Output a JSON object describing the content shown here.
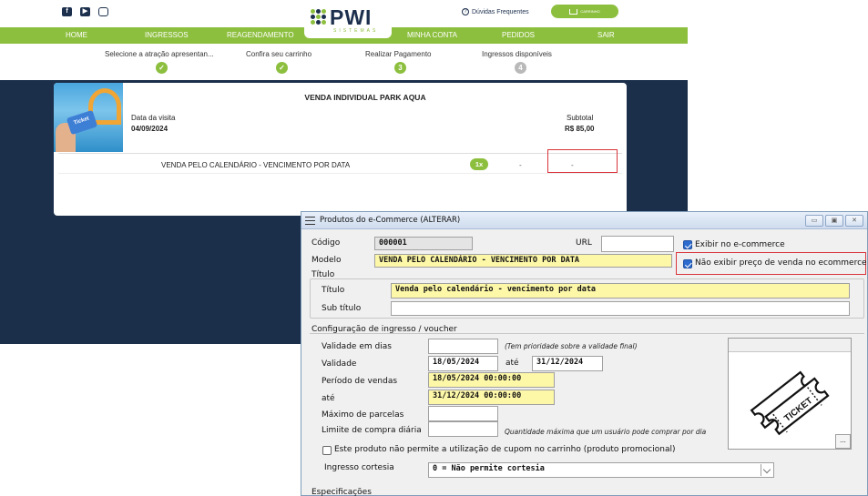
{
  "site": {
    "logo_text": "PWI",
    "logo_sub": "SISTEMAS",
    "faq_label": "Dúvidas Frequentes",
    "cart_label": "CARRINHO",
    "nav": [
      "HOME",
      "INGRESSOS",
      "REAGENDAMENTO",
      "MINHA CONTA",
      "PEDIDOS",
      "SAIR"
    ],
    "steps": [
      {
        "label": "Selecione a atração apresentan...",
        "state": "done"
      },
      {
        "label": "Confira seu carrinho",
        "state": "done"
      },
      {
        "label": "Realizar Pagamento",
        "number": "3",
        "state": "current"
      },
      {
        "label": "Ingressos disponíveis",
        "number": "4",
        "state": "pending"
      }
    ],
    "card": {
      "thumb_text": "Ticket",
      "title": "VENDA INDIVIDUAL PARK AQUA",
      "visit_label": "Data da visita",
      "visit_value": "04/09/2024",
      "subtotal_label": "Subtotal",
      "subtotal_value": "R$ 85,00",
      "item_name": "VENDA PELO CALENDÁRIO - VENCIMENTO POR DATA",
      "qty": "1x",
      "dash_a": "-",
      "dash_b": "-"
    },
    "colors": {
      "green": "#8dbf3f",
      "navy": "#1b2f4a",
      "highlight": "#d9353b"
    }
  },
  "dialog": {
    "title": "Produtos do e-Commerce (ALTERAR)",
    "codigo_label": "Código",
    "codigo_value": "000001",
    "url_label": "URL",
    "url_value": "",
    "exibir_label": "Exibir no e-commerce",
    "exibir_checked": true,
    "nao_exibir_label": "Não exibir preço de venda no ecommerce",
    "nao_exibir_checked": true,
    "modelo_label": "Modelo",
    "modelo_value": "VENDA PELO CALENDÁRIO - VENCIMENTO POR DATA",
    "titulo_group": "Título",
    "titulo_label": "Título",
    "titulo_value": "Venda pelo calendário - vencimento por data",
    "subtitulo_label": "Sub título",
    "subtitulo_value": "",
    "config_group": "Configuração de ingresso / voucher",
    "validade_dias_label": "Validade em dias",
    "validade_dias_value": "",
    "validade_note": "(Tem prioridade sobre a validade final)",
    "validade_label": "Validade",
    "validade_de": "18/05/2024",
    "ate_label": "até",
    "validade_ate": "31/12/2024",
    "periodo_label": "Período de vendas",
    "periodo_de": "18/05/2024 00:00:00",
    "ate2_label": "até",
    "periodo_ate": "31/12/2024 00:00:00",
    "parcelas_label": "Máximo de parcelas",
    "parcelas_value": "",
    "limite_label": "Limiite de compra diária",
    "limite_value": "",
    "limite_note": "Quantidade máxima que um usuário pode comprar por dia",
    "cupom_label": "Este produto não permite a utilização de cupom no carrinho (produto promocional)",
    "cupom_checked": false,
    "cortesia_label": "Ingresso cortesia",
    "cortesia_value": "0 = Não permite cortesia",
    "image_text": "TICKET",
    "image_button": "...",
    "especificacoes_label": "Especificações"
  }
}
